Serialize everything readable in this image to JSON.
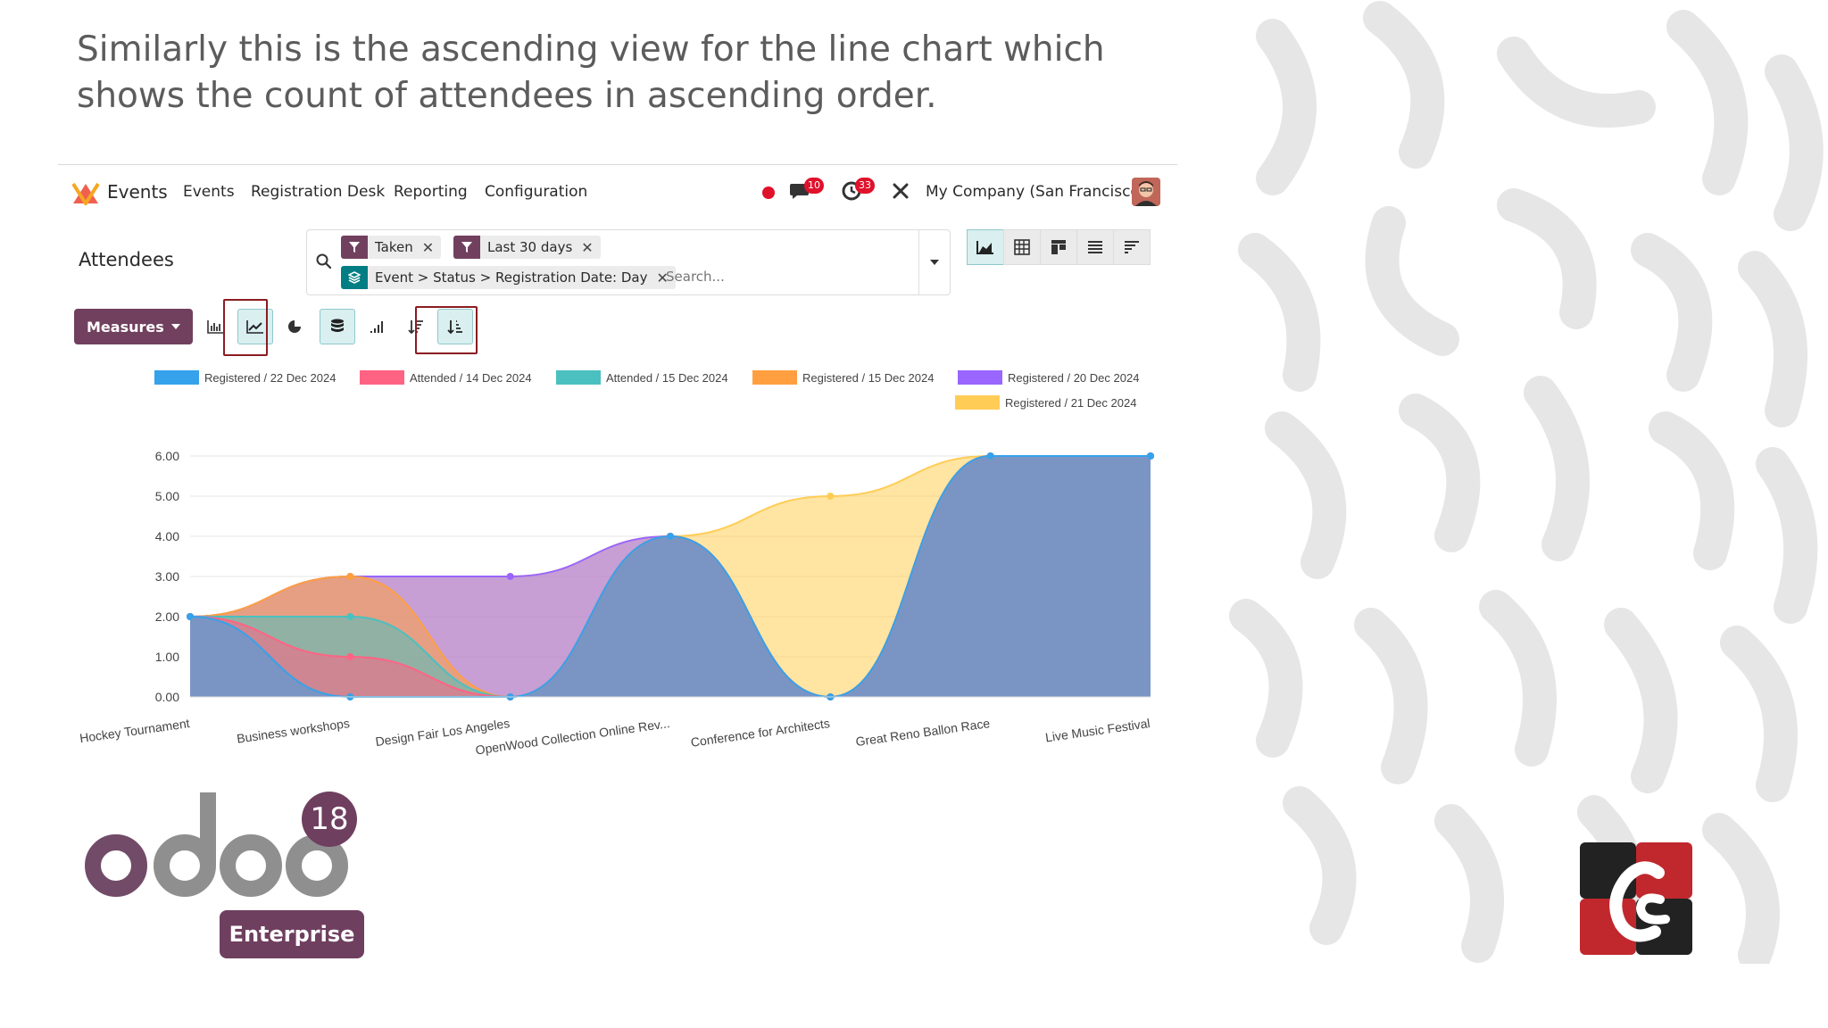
{
  "caption": "Similarly this is the ascending view for the line chart which shows the count of attendees in ascending order.",
  "app": {
    "brand": "Events",
    "menu": [
      "Events",
      "Registration Desk",
      "Reporting",
      "Configuration"
    ],
    "chat_badge": "10",
    "activity_badge": "33",
    "company": "My Company (San Francisco)"
  },
  "control": {
    "title": "Attendees",
    "facets": [
      {
        "label": "Taken",
        "type": "filter",
        "color": "#71405f"
      },
      {
        "label": "Last 30 days",
        "type": "filter",
        "color": "#71405f"
      },
      {
        "label": "Event > Status > Registration Date: Day",
        "type": "groupby",
        "color": "#017e84"
      }
    ],
    "search_placeholder": "Search..."
  },
  "toolbar": {
    "measures_label": "Measures"
  },
  "chart_data": {
    "type": "area",
    "stacked": true,
    "categories": [
      "Hockey Tournament",
      "Business workshops",
      "Design Fair Los Angeles",
      "OpenWood Collection Online Rev...",
      "Conference for Architects",
      "Great Reno Ballon Race",
      "Live Music Festival"
    ],
    "ylim": [
      0,
      6
    ],
    "yticks": [
      "0.00",
      "1.00",
      "2.00",
      "3.00",
      "4.00",
      "5.00",
      "6.00"
    ],
    "grid": true,
    "legend_position": "top",
    "series": [
      {
        "name": "Registered / 22 Dec 2024",
        "color": "#36a2eb",
        "values": [
          2,
          0,
          0,
          4,
          0,
          6,
          6
        ]
      },
      {
        "name": "Attended / 14 Dec 2024",
        "color": "#ff6384",
        "values": [
          0,
          1,
          0,
          0,
          0,
          0,
          0
        ]
      },
      {
        "name": "Attended / 15 Dec 2024",
        "color": "#4bc0c0",
        "values": [
          0,
          1,
          0,
          0,
          0,
          0,
          0
        ]
      },
      {
        "name": "Registered / 15 Dec 2024",
        "color": "#ff9f40",
        "values": [
          0,
          1,
          0,
          0,
          0,
          0,
          0
        ]
      },
      {
        "name": "Registered / 20 Dec 2024",
        "color": "#9966ff",
        "values": [
          0,
          0,
          0,
          0,
          0,
          0,
          0
        ]
      },
      {
        "name": "Registered / 21 Dec 2024",
        "color": "#ffcd56",
        "values": [
          0,
          0,
          0,
          0,
          5,
          0,
          0
        ]
      }
    ],
    "stacked_totals": {
      "Registered / 22 Dec 2024": [
        2,
        0,
        0,
        4,
        0,
        6,
        6
      ],
      "Attended / 14 Dec 2024": [
        2,
        1,
        0,
        4,
        0,
        6,
        6
      ],
      "Attended / 15 Dec 2024": [
        2,
        2,
        0,
        4,
        0,
        6,
        6
      ],
      "Registered / 15 Dec 2024": [
        2,
        3,
        0,
        4,
        0,
        6,
        6
      ],
      "Registered / 20 Dec 2024": [
        2,
        3,
        3,
        4,
        0,
        6,
        6
      ],
      "Registered / 21 Dec 2024": [
        2,
        3,
        3,
        4,
        5,
        6,
        6
      ]
    }
  },
  "branding": {
    "odoo_word": "odoo",
    "version": "18",
    "edition": "Enterprise",
    "accent": "#6f3f5f"
  }
}
